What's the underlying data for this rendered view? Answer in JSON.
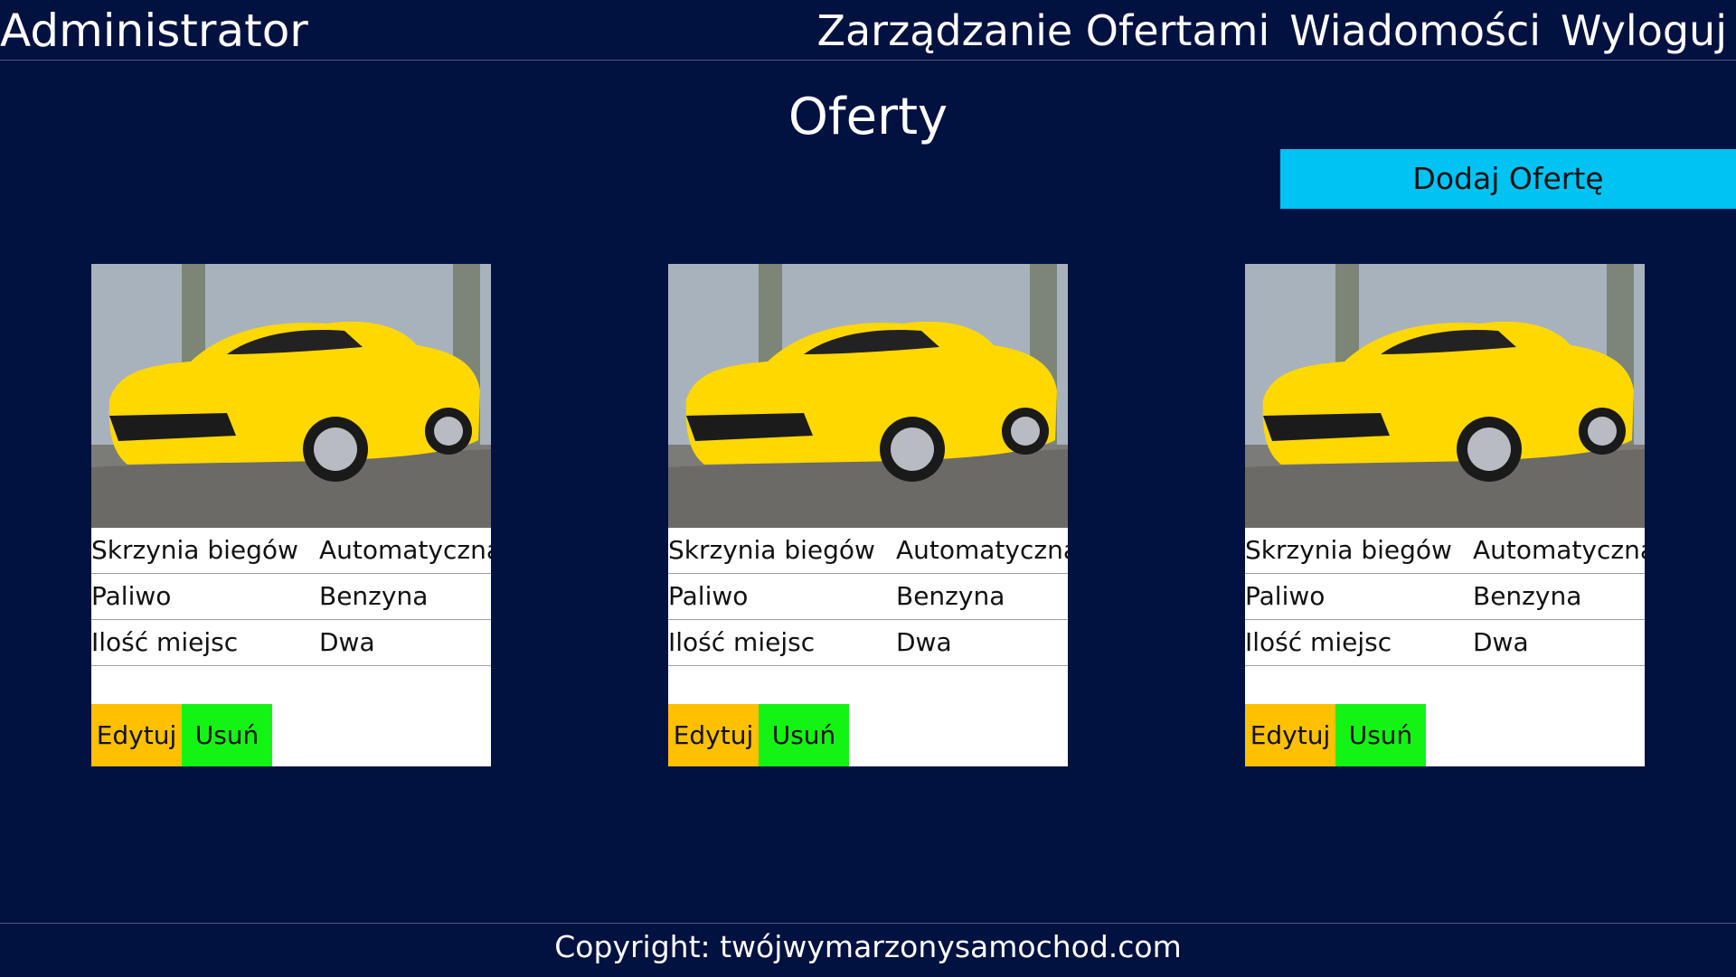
{
  "header": {
    "brand": "Administrator",
    "nav": [
      "Zarządzanie Ofertami",
      "Wiadomości",
      "Wyloguj"
    ]
  },
  "page_title": "Oferty",
  "add_offer_label": "Dodaj Ofertę",
  "offers": [
    {
      "specs": [
        {
          "label": "Skrzynia biegów",
          "value": "Automatyczna"
        },
        {
          "label": "Paliwo",
          "value": "Benzyna"
        },
        {
          "label": "Ilość miejsc",
          "value": "Dwa"
        }
      ],
      "edit_label": "Edytuj",
      "delete_label": "Usuń"
    },
    {
      "specs": [
        {
          "label": "Skrzynia biegów",
          "value": "Automatyczna"
        },
        {
          "label": "Paliwo",
          "value": "Benzyna"
        },
        {
          "label": "Ilość miejsc",
          "value": "Dwa"
        }
      ],
      "edit_label": "Edytuj",
      "delete_label": "Usuń"
    },
    {
      "specs": [
        {
          "label": "Skrzynia biegów",
          "value": "Automatyczna"
        },
        {
          "label": "Paliwo",
          "value": "Benzyna"
        },
        {
          "label": "Ilość miejsc",
          "value": "Dwa"
        }
      ],
      "edit_label": "Edytuj",
      "delete_label": "Usuń"
    }
  ],
  "footer": {
    "copyright": "Copyright: twójwymarzonysamochod.com"
  },
  "colors": {
    "background": "#011140",
    "add_button": "#00c2f3",
    "edit_button": "#ffc000",
    "delete_button": "#14f414",
    "car_body": "#ffd800"
  }
}
